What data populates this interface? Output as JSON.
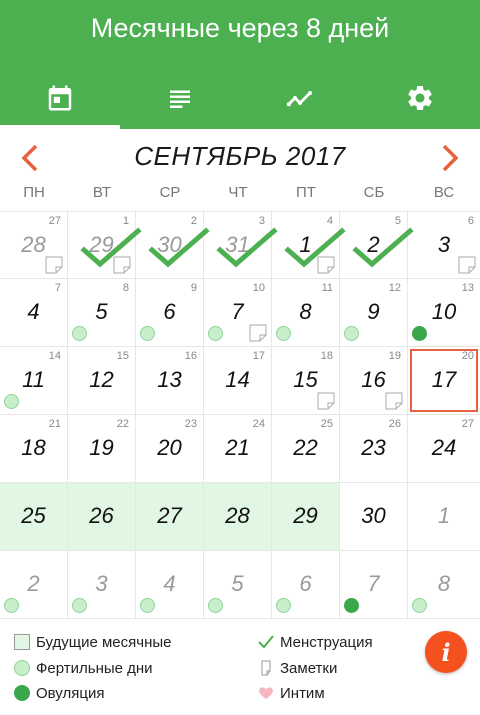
{
  "header": {
    "title": "Месячные через 8 дней",
    "background_color": "#4caf50"
  },
  "tabs": [
    {
      "name": "calendar",
      "icon": "calendar-icon",
      "active": true
    },
    {
      "name": "list",
      "icon": "list-icon",
      "active": false
    },
    {
      "name": "chart",
      "icon": "chart-icon",
      "active": false
    },
    {
      "name": "settings",
      "icon": "gear-icon",
      "active": false
    }
  ],
  "month_bar": {
    "title": "СЕНТЯБРЬ 2017",
    "prev_icon": "chevron-left-icon",
    "next_icon": "chevron-right-icon",
    "arrow_color": "#e8613f"
  },
  "weekdays": [
    "ПН",
    "ВТ",
    "СР",
    "ЧТ",
    "ПТ",
    "СБ",
    "ВС"
  ],
  "weeks": [
    {
      "week": "",
      "days": [
        {
          "d": "28",
          "other": true,
          "wk": "27",
          "note": true
        },
        {
          "d": "29",
          "other": true,
          "wk": "1",
          "check": true,
          "note": true
        },
        {
          "d": "30",
          "other": true,
          "wk": "2",
          "check": true
        },
        {
          "d": "31",
          "other": true,
          "wk": "3",
          "check": true
        },
        {
          "d": "1",
          "wk": "4",
          "check": true,
          "note": true
        },
        {
          "d": "2",
          "wk": "5",
          "check": true
        },
        {
          "d": "3",
          "wk": "6",
          "note": true
        }
      ]
    },
    {
      "week": "",
      "days": [
        {
          "d": "4",
          "wk": "7"
        },
        {
          "d": "5",
          "wk": "8",
          "dot": "fertile"
        },
        {
          "d": "6",
          "wk": "9",
          "dot": "fertile"
        },
        {
          "d": "7",
          "wk": "10",
          "dot": "fertile",
          "note": true
        },
        {
          "d": "8",
          "wk": "11",
          "dot": "fertile"
        },
        {
          "d": "9",
          "wk": "12",
          "dot": "fertile"
        },
        {
          "d": "10",
          "wk": "13",
          "dot": "ovulation"
        }
      ]
    },
    {
      "week": "",
      "days": [
        {
          "d": "11",
          "wk": "14",
          "dot": "fertile"
        },
        {
          "d": "12",
          "wk": "15"
        },
        {
          "d": "13",
          "wk": "16"
        },
        {
          "d": "14",
          "wk": "17"
        },
        {
          "d": "15",
          "wk": "18",
          "note": true
        },
        {
          "d": "16",
          "wk": "19",
          "note": true
        },
        {
          "d": "17",
          "wk": "20",
          "today": true
        }
      ]
    },
    {
      "week": "",
      "days": [
        {
          "d": "18",
          "wk": "21"
        },
        {
          "d": "19",
          "wk": "22"
        },
        {
          "d": "20",
          "wk": "23"
        },
        {
          "d": "21",
          "wk": "24"
        },
        {
          "d": "22",
          "wk": "25"
        },
        {
          "d": "23",
          "wk": "26"
        },
        {
          "d": "24",
          "wk": "27"
        }
      ]
    },
    {
      "week": "",
      "days": [
        {
          "d": "25",
          "future": true
        },
        {
          "d": "26",
          "future": true
        },
        {
          "d": "27",
          "future": true
        },
        {
          "d": "28",
          "future": true
        },
        {
          "d": "29",
          "future": true
        },
        {
          "d": "30"
        },
        {
          "d": "1",
          "other": true
        }
      ]
    },
    {
      "week": "",
      "days": [
        {
          "d": "2",
          "other": true,
          "dot": "fertile"
        },
        {
          "d": "3",
          "other": true,
          "dot": "fertile"
        },
        {
          "d": "4",
          "other": true,
          "dot": "fertile"
        },
        {
          "d": "5",
          "other": true,
          "dot": "fertile"
        },
        {
          "d": "6",
          "other": true,
          "dot": "fertile"
        },
        {
          "d": "7",
          "other": true,
          "dot": "ovulation"
        },
        {
          "d": "8",
          "other": true,
          "dot": "fertile"
        }
      ]
    }
  ],
  "legend": {
    "future_period": "Будущие месячные",
    "fertile": "Фертильные дни",
    "ovulation": "Овуляция",
    "menstruation": "Менструация",
    "notes": "Заметки",
    "intimacy": "Интим"
  },
  "info_button": {
    "label": "i",
    "icon": "info-icon",
    "color": "#f4511e"
  },
  "colors": {
    "check": "#4caf50",
    "today_border": "#e8613f",
    "future_fill": "#e1f7e3",
    "heart": "#f7b6c2"
  }
}
